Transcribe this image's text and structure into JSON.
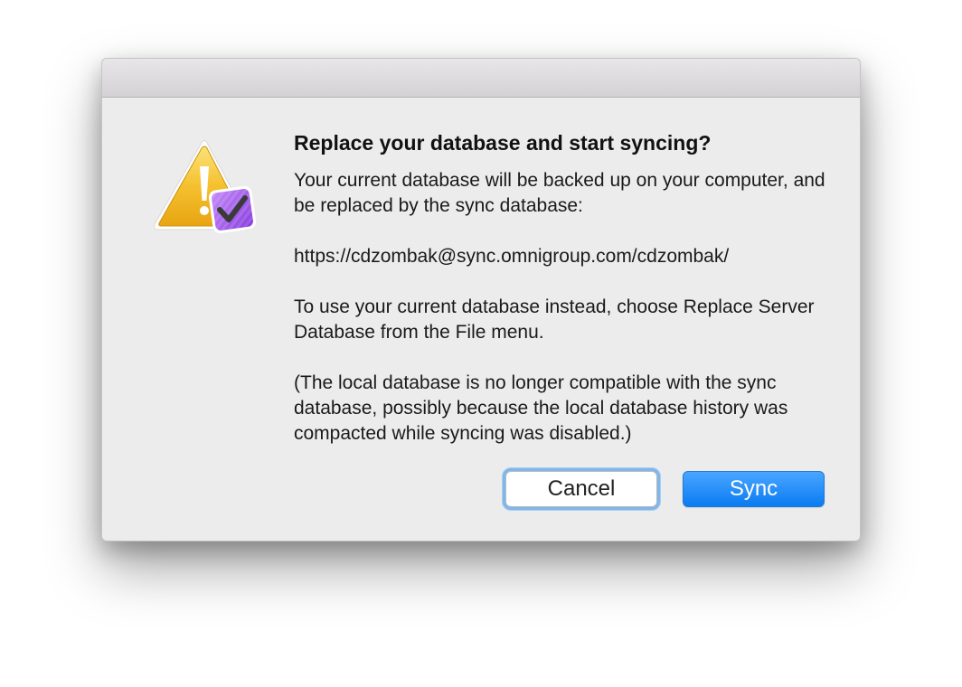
{
  "dialog": {
    "title": "Replace your database and start syncing?",
    "paragraphs": [
      "Your current database will be backed up on your computer, and be replaced by the sync database:",
      "https://cdzombak@sync.omnigroup.com/cdzombak/",
      "To use your current database instead, choose Replace Server Database from the File menu.",
      "(The local database is no longer compatible with the sync database, possibly because the local database history was compacted while syncing was disabled.)"
    ],
    "icon": "warning-triangle-with-omnifocus-check-icon",
    "buttons": {
      "cancel": "Cancel",
      "sync": "Sync"
    }
  },
  "colors": {
    "dialog_background": "#ececec",
    "warning_yellow": "#f4b824",
    "badge_purple": "#9b4de8",
    "primary_button": "#1a86f8"
  }
}
